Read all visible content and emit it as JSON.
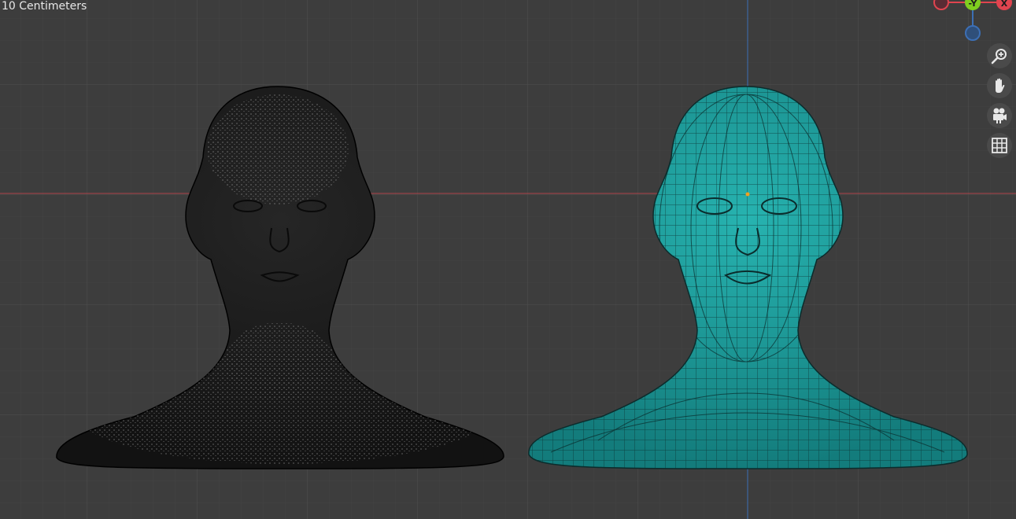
{
  "viewport": {
    "grid_scale_label": "10 Centimeters",
    "background_color": "#3d3d3d",
    "grid_color": "#4f4f4f",
    "x_axis_color": "#b0444a",
    "z_axis_color": "#3c6fb5"
  },
  "gizmo": {
    "y_label": "-Y",
    "x_label": "X",
    "x_color": "#e0444f",
    "y_color": "#7fcf1f",
    "z_color": "#3c6fb5"
  },
  "nav_tools": [
    {
      "name": "zoom-icon"
    },
    {
      "name": "pan-hand-icon"
    },
    {
      "name": "camera-icon"
    },
    {
      "name": "grid-projection-icon"
    }
  ],
  "objects": {
    "left_head_color": "#1c1c1c",
    "left_vertex_color": "#c8c8c8",
    "right_head_color": "#1f9e9e",
    "right_wire_color": "#0b2c2c",
    "origin_color": "#f0a020"
  }
}
